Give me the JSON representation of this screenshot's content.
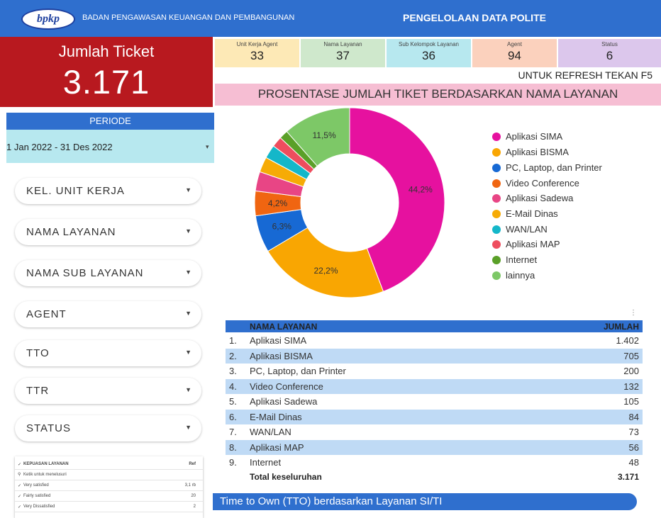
{
  "header": {
    "logo_text": "bpkp",
    "org_name": "BADAN PENGAWASAN KEUANGAN DAN PEMBANGUNAN",
    "title": "PENGELOLAAN DATA POLITE",
    "colors": {
      "header_blue": "#2f6fce",
      "ticket_red": "#b8191f"
    }
  },
  "ticket": {
    "label": "Jumlah Ticket",
    "value": "3.171"
  },
  "stats": [
    {
      "label": "Unit Kerja Agent",
      "value": "33",
      "color": "#fde9b6"
    },
    {
      "label": "Nama Layanan",
      "value": "37",
      "color": "#cfe8cc"
    },
    {
      "label": "Sub Kelompok Layanan",
      "value": "36",
      "color": "#b7e8ef"
    },
    {
      "label": "Agent",
      "value": "94",
      "color": "#fbd1bd"
    },
    {
      "label": "Status",
      "value": "6",
      "color": "#dcc7ec"
    }
  ],
  "refresh_note": "UNTUK REFRESH TEKAN F5",
  "chart_title": "PROSENTASE JUMLAH  TIKET BERDASARKAN NAMA LAYANAN",
  "periode": {
    "label": "PERIODE",
    "value": "1 Jan 2022 - 31 Des 2022",
    "caret": "▾"
  },
  "filters": [
    {
      "label": "KEL. UNIT KERJA"
    },
    {
      "label": "NAMA LAYANAN"
    },
    {
      "label": "NAMA SUB LAYANAN"
    },
    {
      "label": "AGENT"
    },
    {
      "label": "TTO"
    },
    {
      "label": "TTR"
    },
    {
      "label": "STATUS"
    }
  ],
  "kepuasan": {
    "header": "KEPUASAN LAYANAN",
    "ref": "Ref",
    "search_placeholder": "Ketik untuk menelusuri",
    "options": [
      {
        "label": "Very satisfied",
        "value": "3,1 rb"
      },
      {
        "label": "Fairly satisfied",
        "value": "20"
      },
      {
        "label": "Very Dissatisfied",
        "value": "2"
      }
    ]
  },
  "chart_data": {
    "type": "pie",
    "donut": true,
    "legend_position": "right",
    "slices": [
      {
        "name": "Aplikasi SIMA",
        "percent": 44.2,
        "label": "44,2%",
        "color": "#e6119f"
      },
      {
        "name": "Aplikasi BISMA",
        "percent": 22.2,
        "label": "22,2%",
        "color": "#f9a602"
      },
      {
        "name": "PC, Laptop, dan Printer",
        "percent": 6.3,
        "label": "6,3%",
        "color": "#1769d4"
      },
      {
        "name": "Video Conference",
        "percent": 4.2,
        "label": "4,2%",
        "color": "#f06511"
      },
      {
        "name": "Aplikasi Sadewa",
        "percent": 3.3,
        "label": "",
        "color": "#e84585"
      },
      {
        "name": "E-Mail Dinas",
        "percent": 2.6,
        "label": "",
        "color": "#f6ab06"
      },
      {
        "name": "WAN/LAN",
        "percent": 2.3,
        "label": "",
        "color": "#14b7c9"
      },
      {
        "name": "Aplikasi MAP",
        "percent": 1.8,
        "label": "",
        "color": "#ee4d5e"
      },
      {
        "name": "Internet",
        "percent": 1.5,
        "label": "",
        "color": "#5aa028"
      },
      {
        "name": "lainnya",
        "percent": 11.5,
        "label": "11,5%",
        "color": "#7dc867"
      }
    ]
  },
  "table": {
    "header_name": "NAMA LAYANAN",
    "header_value": "JUMLAH",
    "menu_icon": "⋮",
    "rows": [
      {
        "no": "1.",
        "name": "Aplikasi SIMA",
        "value": "1.402"
      },
      {
        "no": "2.",
        "name": "Aplikasi BISMA",
        "value": "705"
      },
      {
        "no": "3.",
        "name": "PC, Laptop, dan Printer",
        "value": "200"
      },
      {
        "no": "4.",
        "name": "Video Conference",
        "value": "132"
      },
      {
        "no": "5.",
        "name": "Aplikasi Sadewa",
        "value": "105"
      },
      {
        "no": "6.",
        "name": "E-Mail Dinas",
        "value": "84"
      },
      {
        "no": "7.",
        "name": "WAN/LAN",
        "value": "73"
      },
      {
        "no": "8.",
        "name": "Aplikasi MAP",
        "value": "56"
      },
      {
        "no": "9.",
        "name": "Internet",
        "value": "48"
      }
    ],
    "total_label": "Total keseluruhan",
    "total_value": "3.171"
  },
  "tto_title": "Time to Own (TTO) berdasarkan Layanan SI/TI"
}
